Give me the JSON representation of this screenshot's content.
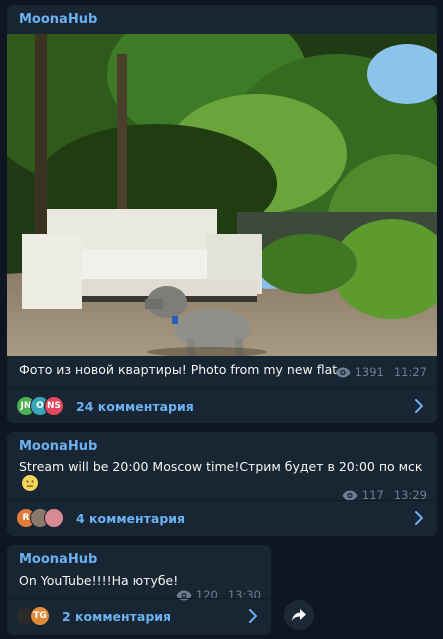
{
  "posts": [
    {
      "channel": "MoonaHub",
      "text": "Фото из новой квартиры! Photo from my new flat.",
      "views": "1391",
      "time": "11:27",
      "comments_label": "24 комментария",
      "avatars": [
        {
          "initials": "JN",
          "color": "#4caf50"
        },
        {
          "initials": "O",
          "color": "#39a6b5"
        },
        {
          "initials": "NS",
          "color": "#e5485c"
        }
      ]
    },
    {
      "channel": "MoonaHub",
      "text": "Stream will be 20:00 Moscow time!Стрим будет в 20:00 по мск",
      "views": "117",
      "time": "13:29",
      "comments_label": "4 комментария",
      "avatars": [
        {
          "initials": "R",
          "color": "#e07b39"
        }
      ]
    },
    {
      "channel": "MoonaHub",
      "text": "On YouTube!!!!На ютубе!",
      "views": "120",
      "time": "13:30",
      "comments_label": "2 комментария",
      "avatars": [
        {
          "initials": "TG",
          "color": "#e08a3a"
        }
      ]
    }
  ],
  "colors": {
    "background": "#0e1621",
    "bubble": "#182533",
    "accent": "#6cb2f2",
    "meta": "#6d7f8f"
  },
  "icons": [
    "eye-icon",
    "chevron-right-icon",
    "share-icon",
    "emoji-icon"
  ]
}
